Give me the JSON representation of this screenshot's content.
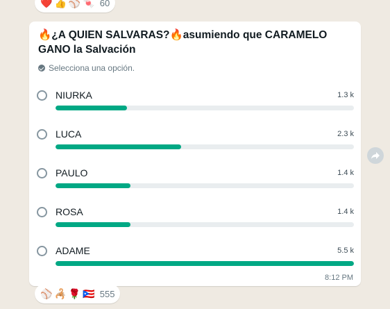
{
  "reactions_top": {
    "emojis": [
      "❤️",
      "👍",
      "⚾",
      "🍬"
    ],
    "count": "60"
  },
  "poll": {
    "title": "🔥¿A QUIEN SALVARAS?🔥asumiendo que CARAMELO GANO la Salvación",
    "hint": "Selecciona una opción.",
    "options": [
      {
        "label": "NIURKA",
        "count": "1.3 k",
        "fraction": 0.24
      },
      {
        "label": "LUCA",
        "count": "2.3 k",
        "fraction": 0.42
      },
      {
        "label": "PAULO",
        "count": "1.4 k",
        "fraction": 0.25
      },
      {
        "label": "ROSA",
        "count": "1.4 k",
        "fraction": 0.25
      },
      {
        "label": "ADAME",
        "count": "5.5 k",
        "fraction": 1.0
      }
    ],
    "time": "8:12 PM"
  },
  "reactions_bottom": {
    "emojis": [
      "⚾",
      "🦂",
      "🌹",
      "🇵🇷"
    ],
    "count": "555"
  },
  "colors": {
    "accent": "#00a884",
    "track": "#e9edef",
    "background": "#efeae2"
  },
  "icons": {
    "hint": "check-circle-icon",
    "forward": "forward-arrow-icon"
  }
}
